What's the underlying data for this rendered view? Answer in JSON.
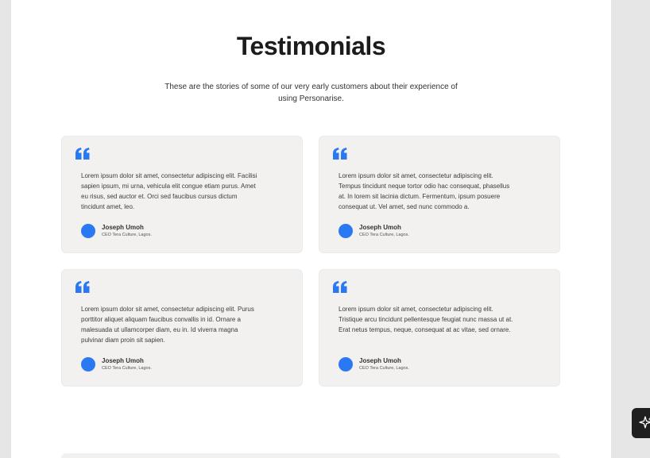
{
  "section": {
    "title": "Testimonials",
    "subtitle": "These are the stories of some of our very early customers about their experience of using Personarise."
  },
  "testimonials": [
    {
      "text": "Lorem ipsum dolor sit amet, consectetur adipiscing elit. Facilisi sapien ipsum, mi urna, vehicula elit congue etiam purus. Amet eu risus, sed auctor et. Orci sed faucibus cursus dictum tincidunt amet, leo.",
      "name": "Joseph Umoh",
      "role": "CEO Tera Culture, Lagos."
    },
    {
      "text": "Lorem ipsum dolor sit amet, consectetur adipiscing elit. Tempus tincidunt neque tortor odio hac consequat, phasellus at. In lorem sit lacinia dictum. Fermentum, ipsum posuere consequat ut. Vel amet, sed nunc commodo a.",
      "name": "Joseph Umoh",
      "role": "CEO Tera Culture, Lagos."
    },
    {
      "text": "Lorem ipsum dolor sit amet, consectetur adipiscing elit. Purus porttitor aliquet aliquam faucibus convallis in id. Ornare a malesuada ut ullamcorper diam, eu in. Id viverra magna pulvinar diam proin sit sapien.",
      "name": "Joseph Umoh",
      "role": "CEO Tera Culture, Lagos."
    },
    {
      "text": "Lorem ipsum dolor sit amet, consectetur adipiscing elit. Tristique arcu tincidunt pellentesque feugiat nunc massa ut at. Erat netus tempus, neque, consequat at ac vitae, sed ornare.",
      "name": "Joseph Umoh",
      "role": "CEO Tera Culture, Lagos."
    }
  ],
  "icons": {
    "quote": "quote-icon",
    "ai_assistant": "sparkle-icon"
  },
  "colors": {
    "accent": "#2b79f2",
    "card_bg": "#f2f1f0",
    "page_bg": "#ffffff"
  }
}
